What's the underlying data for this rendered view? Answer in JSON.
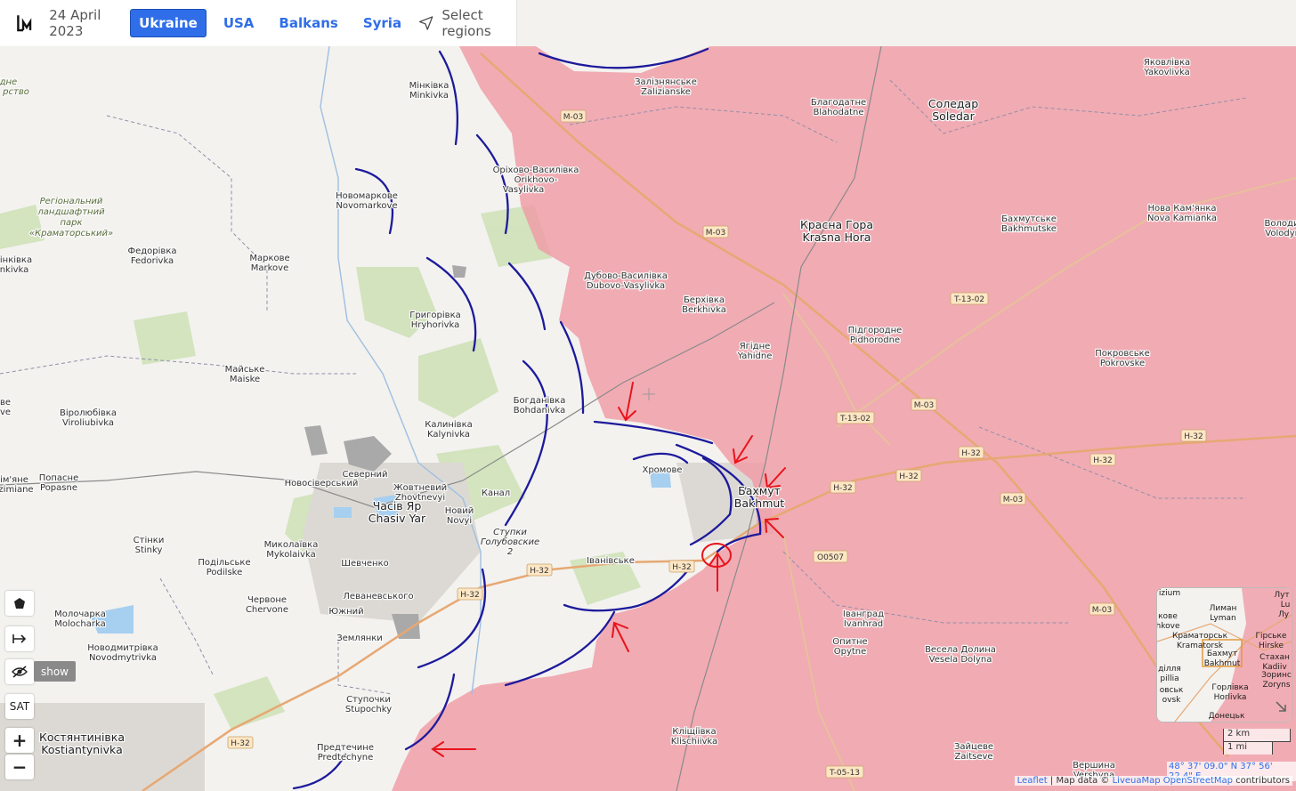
{
  "header": {
    "date": "24 April 2023",
    "tabs": [
      {
        "label": "Ukraine",
        "active": true
      },
      {
        "label": "USA",
        "active": false
      },
      {
        "label": "Balkans",
        "active": false
      },
      {
        "label": "Syria",
        "active": false
      }
    ],
    "select_regions": "Select regions",
    "icons": {
      "logo": "liveuamap-logo-icon",
      "select": "navigation-arrow-icon"
    }
  },
  "colors": {
    "occupied": "#f09ba6",
    "frontline": "#1d1a9c",
    "arrows": "#e8141c",
    "land": "#f3f2ef",
    "accent": "#2f6ee8"
  },
  "map": {
    "places": [
      {
        "id": "minkivka",
        "ua": "Мінківка",
        "en": "Minkivka"
      },
      {
        "id": "zaliznianske",
        "ua": "Залізнянське",
        "en": "Zalizianske"
      },
      {
        "id": "blahodatne",
        "ua": "Благодатне",
        "en": "Blahodatne"
      },
      {
        "id": "soledar",
        "ua": "Соледар",
        "en": "Soledar"
      },
      {
        "id": "yakovlivka",
        "ua": "Яковлівка",
        "en": "Yakovlivka"
      },
      {
        "id": "orikhovo",
        "ua": "Оріхово-Василівка",
        "en": "Orikhovo-",
        "en2": "Vasylivka"
      },
      {
        "id": "novomarkove",
        "ua": "Новомаркове",
        "en": "Novomarkove"
      },
      {
        "id": "krasna_hora",
        "ua": "Красна Гора",
        "en": "Krasna Hora"
      },
      {
        "id": "bakhmutske",
        "ua": "Бахмутське",
        "en": "Bakhmutske"
      },
      {
        "id": "nova_kamianka",
        "ua": "Нова Кам'янка",
        "en": "Nova Kamianka"
      },
      {
        "id": "volodymyrivka",
        "ua": "Володи",
        "en": "Volodyr"
      },
      {
        "id": "fedorivka",
        "ua": "Федорівка",
        "en": "Fedorivka"
      },
      {
        "id": "markove",
        "ua": "Маркове",
        "en": "Markove"
      },
      {
        "id": "dubovo",
        "ua": "Дубово-Василівка",
        "en": "Dubovo-Vasylivka"
      },
      {
        "id": "berkhivka",
        "ua": "Берхівка",
        "en": "Berkhivka"
      },
      {
        "id": "hryhorivka",
        "ua": "Григорівка",
        "en": "Hryhorivka"
      },
      {
        "id": "yahidne",
        "ua": "Ягідне",
        "en": "Yahidne"
      },
      {
        "id": "pidhorodne",
        "ua": "Підгородне",
        "en": "Pidhorodne"
      },
      {
        "id": "pokrovske",
        "ua": "Покровське",
        "en": "Pokrovske"
      },
      {
        "id": "maiske",
        "ua": "Майське",
        "en": "Maiske"
      },
      {
        "id": "bohdanivka",
        "ua": "Богданівка",
        "en": "Bohdanivka"
      },
      {
        "id": "virolyubivka",
        "ua": "Віролюбівка",
        "en": "Viroliubivka"
      },
      {
        "id": "kalynivka",
        "ua": "Калинівка",
        "en": "Kalynivka"
      },
      {
        "id": "khromove",
        "ua": "Хромове",
        "en": ""
      },
      {
        "id": "bakhmut",
        "ua": "Бахмут",
        "en": "Bakhmut"
      },
      {
        "id": "popasne",
        "ua": "Попасне",
        "en": "Popasne"
      },
      {
        "id": "novosiverskyi",
        "ua": "Новосіверський",
        "en": ""
      },
      {
        "id": "sivernyi",
        "ua": "Северний",
        "en": ""
      },
      {
        "id": "zhovtnevyi",
        "ua": "Жовтневий",
        "en": "Zhovtnevyi"
      },
      {
        "id": "chasiv_yar",
        "ua": "Часів Яр",
        "en": "Chasiv Yar"
      },
      {
        "id": "kanal",
        "ua": "Канал",
        "en": ""
      },
      {
        "id": "novyi",
        "ua": "Новий",
        "en": "Novyi"
      },
      {
        "id": "stupky",
        "ua": "Ступки",
        "en": "Голубовские",
        "en2": "2"
      },
      {
        "id": "stinky",
        "ua": "Стінки",
        "en": "Stinky"
      },
      {
        "id": "mykolaivka",
        "ua": "Миколаївка",
        "en": "Mykolaivka"
      },
      {
        "id": "podilske",
        "ua": "Подільське",
        "en": "Podilske"
      },
      {
        "id": "shevchenko",
        "ua": "Шевченко",
        "en": ""
      },
      {
        "id": "ivanivske",
        "ua": "Іванівське",
        "en": ""
      },
      {
        "id": "chervone",
        "ua": "Червоне",
        "en": "Chervone"
      },
      {
        "id": "levanevskoho",
        "ua": "Леваневського",
        "en": ""
      },
      {
        "id": "molocharka",
        "ua": "Молочарка",
        "en": "Molocharka"
      },
      {
        "id": "yuzhnyi",
        "ua": "Южний",
        "en": ""
      },
      {
        "id": "ivanhrad",
        "ua": "Іванград",
        "en": "Ivanhrad"
      },
      {
        "id": "novodmytrivka",
        "ua": "Новодмитрівка",
        "en": "Novodmytrivka"
      },
      {
        "id": "zemlianky",
        "ua": "Землянки",
        "en": ""
      },
      {
        "id": "opytne",
        "ua": "Опитне",
        "en": "Opytne"
      },
      {
        "id": "vesela_dolyna",
        "ua": "Весела Долина",
        "en": "Vesela Dolyna"
      },
      {
        "id": "stupochky",
        "ua": "Ступочки",
        "en": "Stupochky"
      },
      {
        "id": "kostiantynivka",
        "ua": "Костянтинівка",
        "en": "Kostiantynivka"
      },
      {
        "id": "predtechyne",
        "ua": "Предтечине",
        "en": "Predtechyne"
      },
      {
        "id": "klishchiivka",
        "ua": "Кліщіївка",
        "en": "Klischiivka"
      },
      {
        "id": "zaitseve",
        "ua": "Зайцеве",
        "en": "Zaitseve"
      },
      {
        "id": "vershyna",
        "ua": "Вершина",
        "en": "Vershyna"
      },
      {
        "id": "park",
        "ua": "Регіональний",
        "en": "ландшафтний",
        "en2": "парк",
        "en3": "«Краматорський»"
      },
      {
        "id": "minkivka_w",
        "ua": "інківка",
        "en": "nkivka"
      },
      {
        "id": "vladove",
        "ua": "ве",
        "en": "ve"
      },
      {
        "id": "zimiane",
        "ua": "ім'яне",
        "en": "zimiane"
      },
      {
        "id": "edge_nw",
        "ua": "ідне",
        "en": "рство"
      }
    ],
    "roads": [
      "M-03",
      "M-03",
      "M-03",
      "M-03",
      "T-13-02",
      "T-13-02",
      "H-32",
      "H-32",
      "H-32",
      "H-32",
      "H-32",
      "H-32",
      "H-32",
      "H-32",
      "M-03",
      "O0507",
      "T-05-13",
      "H-32"
    ]
  },
  "controls": {
    "polygon_icon": "polygon-icon",
    "measure_icon": "measure-arrow-icon",
    "hide_icon": "eye-slash-icon",
    "show_label": "show",
    "sat_label": "SAT",
    "zoom_in": "+",
    "zoom_out": "−"
  },
  "minimap": {
    "labels": [
      "izium",
      "Лиман",
      "Lyman",
      "кове",
      "hkove",
      "Краматорськ",
      "Kramatorsk",
      "Бахмут",
      "Bakhmut",
      "Гірське",
      "Hirske",
      "Стахан",
      "Kadiiv",
      "Зоринс",
      "Zoryns",
      "ділля",
      "pillia",
      "овськ",
      "ovsk",
      "Горлівка",
      "Horlivka",
      "Донецьк",
      "Лут",
      "Lu",
      "Лу"
    ]
  },
  "scale": {
    "km": "2 km",
    "mi": "1 mi"
  },
  "coords": "48° 37' 09.0\" N 37° 56' 22.4\" E",
  "attribution": {
    "leaflet": "Leaflet",
    "sep1": " | Map data © ",
    "liveuamap": "LiveuaMap",
    "osm": "OpenStreetMap",
    "rest": " contributors"
  }
}
